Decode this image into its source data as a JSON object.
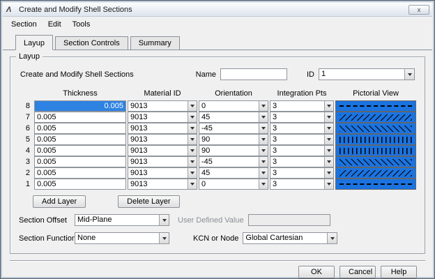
{
  "window": {
    "title": "Create and Modify Shell Sections",
    "close_icon": "x",
    "logo_glyph": "Λ"
  },
  "menu": {
    "items": [
      "Section",
      "Edit",
      "Tools"
    ]
  },
  "tabs": {
    "items": [
      "Layup",
      "Section Controls",
      "Summary"
    ],
    "active": "Layup"
  },
  "layup": {
    "group_label": "Layup",
    "caption": "Create and Modify Shell Sections",
    "name_label": "Name",
    "name_value": "",
    "id_label": "ID",
    "id_value": "1",
    "table": {
      "headers": [
        "Thickness",
        "Material ID",
        "Orientation",
        "Integration Pts",
        "Pictorial View"
      ],
      "rows": [
        {
          "num": "8",
          "thickness": "0.005",
          "material_id": "9013",
          "orientation": "0",
          "integration_pts": "3",
          "selected": true
        },
        {
          "num": "7",
          "thickness": "0.005",
          "material_id": "9013",
          "orientation": "45",
          "integration_pts": "3",
          "selected": false
        },
        {
          "num": "6",
          "thickness": "0.005",
          "material_id": "9013",
          "orientation": "-45",
          "integration_pts": "3",
          "selected": false
        },
        {
          "num": "5",
          "thickness": "0.005",
          "material_id": "9013",
          "orientation": "90",
          "integration_pts": "3",
          "selected": false
        },
        {
          "num": "4",
          "thickness": "0.005",
          "material_id": "9013",
          "orientation": "90",
          "integration_pts": "3",
          "selected": false
        },
        {
          "num": "3",
          "thickness": "0.005",
          "material_id": "9013",
          "orientation": "-45",
          "integration_pts": "3",
          "selected": false
        },
        {
          "num": "2",
          "thickness": "0.005",
          "material_id": "9013",
          "orientation": "45",
          "integration_pts": "3",
          "selected": false
        },
        {
          "num": "1",
          "thickness": "0.005",
          "material_id": "9013",
          "orientation": "0",
          "integration_pts": "3",
          "selected": false
        }
      ]
    },
    "buttons": {
      "add": "Add Layer",
      "delete": "Delete Layer"
    },
    "offset": {
      "label": "Section Offset",
      "value": "Mid-Plane",
      "user_defined_label": "User Defined Value",
      "user_defined_value": ""
    },
    "function": {
      "label": "Section Function",
      "value": "None"
    },
    "kcn": {
      "label": "KCN or Node",
      "value": "Global Cartesian"
    }
  },
  "footer": {
    "ok": "OK",
    "cancel": "Cancel",
    "help": "Help"
  },
  "colors": {
    "pictorial_bg": "#1a73e0",
    "selection_bg": "#2e82e2",
    "pattern_line": "#000000"
  }
}
